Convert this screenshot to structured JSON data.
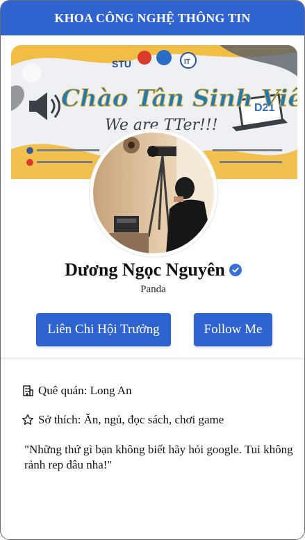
{
  "header": {
    "title": "KHOA CÔNG NGHỆ THÔNG TIN"
  },
  "cover": {
    "headline": "Chào Tân Sinh Viên",
    "tagline": "We are TTer!!!",
    "badge": "D21",
    "logos": [
      "STU",
      "IT"
    ]
  },
  "profile": {
    "name": "Dương Ngọc Nguyên",
    "nickname": "Panda",
    "verified_icon": "verified-check-icon"
  },
  "buttons": {
    "role_label": "Liên Chi Hội Trưởng",
    "follow_label": "Follow Me"
  },
  "info": {
    "hometown": "Quê quán: Long An",
    "hobbies": "Sở thích: Ăn, ngủ, đọc sách, chơi game",
    "quote": "\"Những thứ gì bạn không biết hãy hỏi google. Tui không rảnh rep đâu nha!\""
  },
  "colors": {
    "primary": "#2f63d0",
    "verified": "#3b6fd8",
    "cover_accent_yellow": "#f2b731",
    "cover_text_blue": "#1f7ab5"
  }
}
